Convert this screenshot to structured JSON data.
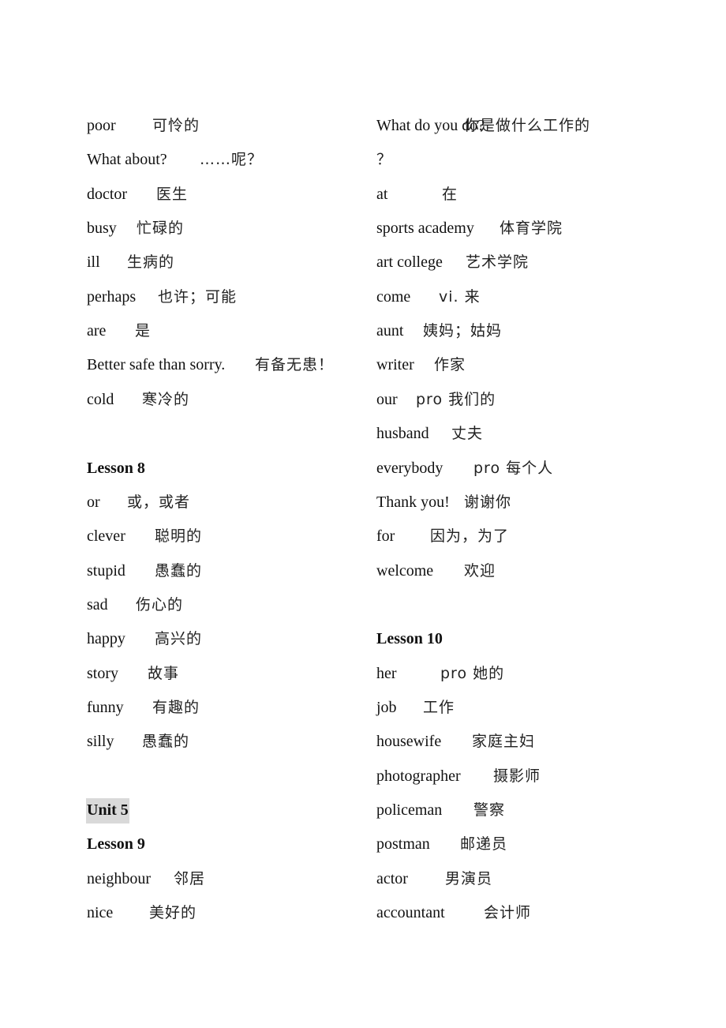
{
  "left_column": [
    {
      "en": "poor",
      "zh": "可怜的"
    },
    {
      "en": "What about?",
      "zh": "……呢？"
    },
    {
      "en": "doctor",
      "zh": "医生"
    },
    {
      "en": "busy",
      "zh": "忙碌的"
    },
    {
      "en": "ill",
      "zh": "生病的"
    },
    {
      "en": "perhaps",
      "zh": "也许；可能"
    },
    {
      "en": "are",
      "zh": "是"
    },
    {
      "en": "Better safe than sorry.",
      "zh": "有备无患！"
    },
    {
      "en": "cold",
      "zh": "寒冷的"
    },
    {
      "heading": "Lesson 8"
    },
    {
      "en": "or",
      "zh": "或，或者"
    },
    {
      "en": "clever",
      "zh": "聪明的"
    },
    {
      "en": "stupid",
      "zh": "愚蠢的"
    },
    {
      "en": "sad",
      "zh": "伤心的"
    },
    {
      "en": "happy",
      "zh": "高兴的"
    },
    {
      "en": "story",
      "zh": "故事"
    },
    {
      "en": "funny",
      "zh": "有趣的"
    },
    {
      "en": "silly",
      "zh": "愚蠢的"
    },
    {
      "heading": "Unit 5",
      "highlight": true
    },
    {
      "heading": "Lesson 9"
    },
    {
      "en": "neighbour",
      "zh": "邻居"
    },
    {
      "en": "nice",
      "zh": "美好的"
    }
  ],
  "right_column": [
    {
      "en": "What do you do?",
      "zh": "你是做什么工作的"
    },
    {
      "en": "",
      "zh": "？"
    },
    {
      "en": "at",
      "zh": "在"
    },
    {
      "en": "sports academy",
      "zh": "体育学院"
    },
    {
      "en": "art college",
      "zh": "艺术学院"
    },
    {
      "en": "come",
      "zh": "vi. 来"
    },
    {
      "en": "aunt",
      "zh": "姨妈；姑妈"
    },
    {
      "en": "writer",
      "zh": "作家"
    },
    {
      "en": "our",
      "zh": "pro 我们的"
    },
    {
      "en": "husband",
      "zh": "丈夫"
    },
    {
      "en": "everybody",
      "zh": "pro 每个人"
    },
    {
      "en": "Thank you!",
      "zh": "谢谢你"
    },
    {
      "en": "for",
      "zh": "因为，为了"
    },
    {
      "en": "welcome",
      "zh": "欢迎"
    },
    {
      "heading": "Lesson 10"
    },
    {
      "en": "her",
      "zh": "pro 她的"
    },
    {
      "en": "job",
      "zh": "工作"
    },
    {
      "en": "housewife",
      "zh": "家庭主妇"
    },
    {
      "en": "photographer",
      "zh": "摄影师"
    },
    {
      "en": "policeman",
      "zh": "警察"
    },
    {
      "en": "postman",
      "zh": "邮递员"
    },
    {
      "en": "actor",
      "zh": "男演员"
    },
    {
      "en": "accountant",
      "zh": "会计师"
    }
  ],
  "colors": {
    "text": "#111111",
    "unit_highlight": "#d9d9d9",
    "background": "#ffffff"
  }
}
